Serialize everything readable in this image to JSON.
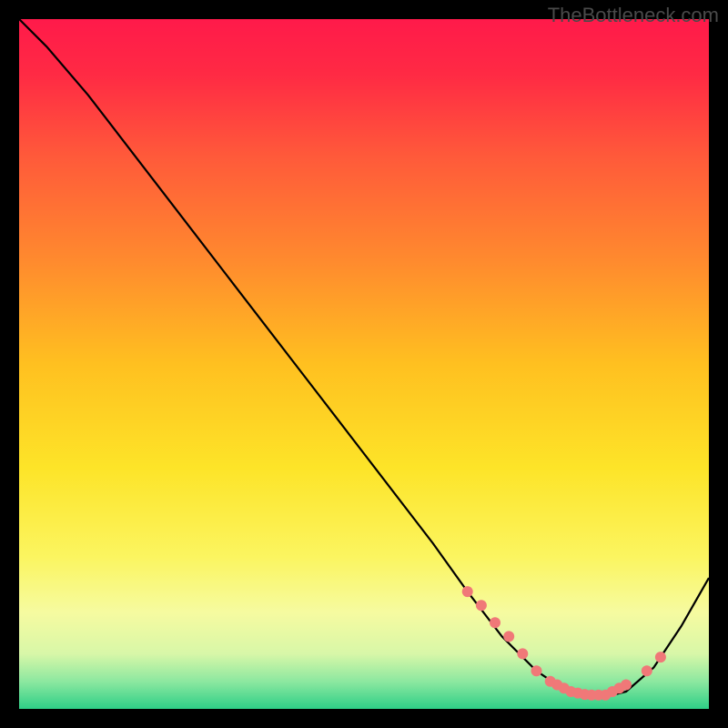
{
  "watermark": "TheBottleneck.com",
  "chart_data": {
    "type": "line",
    "title": "",
    "xlabel": "",
    "ylabel": "",
    "xlim": [
      0,
      100
    ],
    "ylim": [
      0,
      100
    ],
    "background_gradient": {
      "stops": [
        {
          "offset": 0.0,
          "color": "#ff1a4a"
        },
        {
          "offset": 0.08,
          "color": "#ff2a44"
        },
        {
          "offset": 0.2,
          "color": "#ff5a3a"
        },
        {
          "offset": 0.35,
          "color": "#ff8a2e"
        },
        {
          "offset": 0.5,
          "color": "#ffc020"
        },
        {
          "offset": 0.65,
          "color": "#fde428"
        },
        {
          "offset": 0.78,
          "color": "#fbf560"
        },
        {
          "offset": 0.86,
          "color": "#f6fba0"
        },
        {
          "offset": 0.92,
          "color": "#d8f7a8"
        },
        {
          "offset": 0.96,
          "color": "#8de8a0"
        },
        {
          "offset": 1.0,
          "color": "#2ecf87"
        }
      ]
    },
    "series": [
      {
        "name": "bottleneck-curve",
        "color": "#000000",
        "x": [
          0,
          4,
          10,
          20,
          30,
          40,
          50,
          60,
          65,
          70,
          75,
          78,
          80,
          83,
          86,
          88,
          92,
          96,
          100
        ],
        "y": [
          100,
          96,
          89,
          76,
          63,
          50,
          37,
          24,
          17,
          10.5,
          5.5,
          3.5,
          2.5,
          2,
          2,
          2.5,
          6,
          12,
          19
        ]
      }
    ],
    "markers": {
      "name": "highlight-dots",
      "color": "#f07878",
      "radius": 6,
      "x": [
        65,
        67,
        69,
        71,
        73,
        75,
        77,
        78,
        79,
        80,
        81,
        82,
        83,
        84,
        85,
        86,
        87,
        88,
        91,
        93
      ],
      "y": [
        17,
        15,
        12.5,
        10.5,
        8,
        5.5,
        4,
        3.5,
        3,
        2.5,
        2.3,
        2.1,
        2,
        2,
        2,
        2.5,
        3,
        3.5,
        5.5,
        7.5
      ]
    }
  }
}
